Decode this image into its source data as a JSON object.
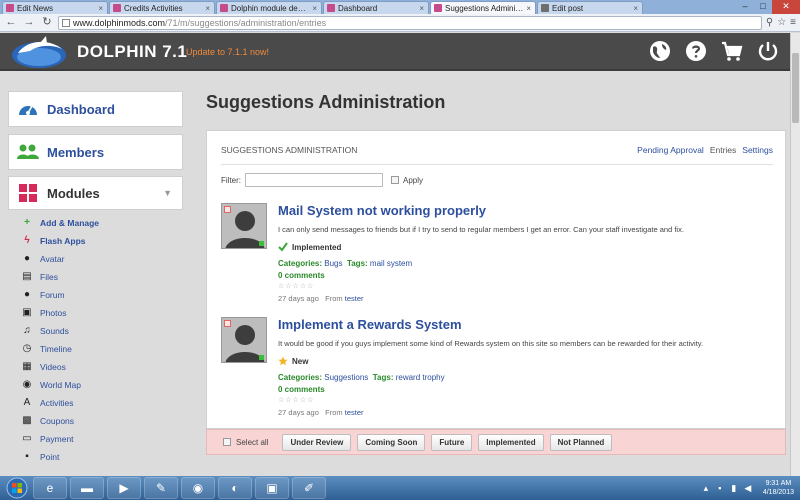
{
  "browser": {
    "tabs": [
      {
        "label": "Edit News",
        "active": false
      },
      {
        "label": "Credits Activities",
        "active": false
      },
      {
        "label": "Dolphin module demo si...",
        "active": false
      },
      {
        "label": "Dashboard",
        "active": false
      },
      {
        "label": "Suggestions Administra...",
        "active": true
      },
      {
        "label": "Edit post",
        "active": false
      }
    ],
    "url_host": "www.dolphinmods.com",
    "url_path": "/71/m/suggestions/administration/entries"
  },
  "header": {
    "brand": "DOLPHIN 7.1",
    "update_link": "Update to 7.1.1 now!"
  },
  "sidebar": {
    "dashboard": "Dashboard",
    "members": "Members",
    "modules": "Modules",
    "items": [
      {
        "label": "Add & Manage"
      },
      {
        "label": "Flash Apps"
      },
      {
        "label": "Avatar"
      },
      {
        "label": "Files"
      },
      {
        "label": "Forum"
      },
      {
        "label": "Photos"
      },
      {
        "label": "Sounds"
      },
      {
        "label": "Timeline"
      },
      {
        "label": "Videos"
      },
      {
        "label": "World Map"
      },
      {
        "label": "Activities"
      },
      {
        "label": "Coupons"
      },
      {
        "label": "Payment"
      },
      {
        "label": "Point"
      }
    ]
  },
  "main": {
    "title": "Suggestions Administration",
    "panel_title": "SUGGESTIONS ADMINISTRATION",
    "links": {
      "pending": "Pending Approval",
      "entries": "Entries",
      "settings": "Settings"
    },
    "filter": {
      "label": "Filter:",
      "value": "",
      "apply": "Apply"
    },
    "entries": [
      {
        "title": "Mail System not working properly",
        "description": "I can only send messages to friends but if I try to send to regular members I get an error. Can your staff investigate and fix.",
        "status": "Implemented",
        "categories_label": "Categories:",
        "category": "Bugs",
        "tags_label": "Tags:",
        "tags": "mail system",
        "comments": "0 comments",
        "time": "27 days ago",
        "from_label": "From",
        "author": "tester"
      },
      {
        "title": "Implement a Rewards System",
        "description": "It would be good if you guys implement some kind of Rewards system on this site so members can be rewarded for their activity.",
        "status": "New",
        "categories_label": "Categories:",
        "category": "Suggestions",
        "tags_label": "Tags:",
        "tags": "reward trophy",
        "comments": "0 comments",
        "time": "27 days ago",
        "from_label": "From",
        "author": "tester"
      }
    ],
    "actions": {
      "select_all": "Select all",
      "buttons": [
        "Under Review",
        "Coming Soon",
        "Future",
        "Implemented",
        "Not Planned"
      ]
    }
  },
  "taskbar": {
    "time": "9:31 AM",
    "date": "4/18/2013"
  },
  "colors": {
    "header_bg": "#4a4a4a",
    "link": "#2d4f9d",
    "update": "#f08a3b",
    "action_bar": "#f8d4d4",
    "green": "#2a8a2a"
  }
}
